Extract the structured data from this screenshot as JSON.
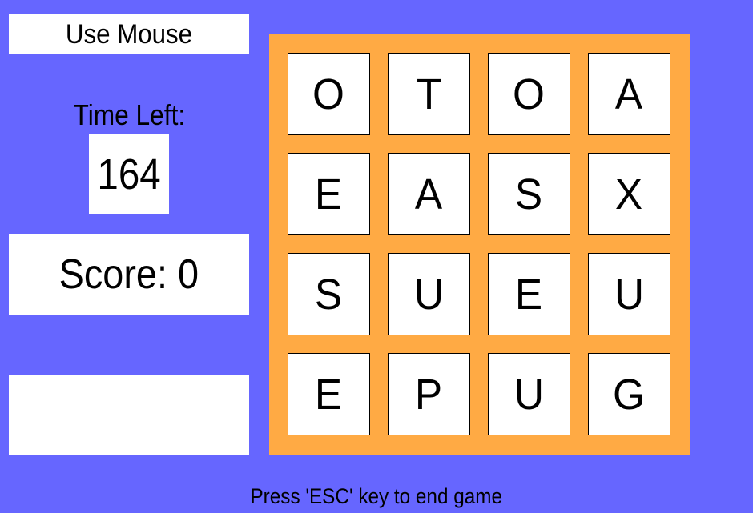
{
  "mode_label": "Use Mouse",
  "time": {
    "label": "Time Left:",
    "value": "164"
  },
  "score": {
    "label": "Score: 0"
  },
  "current_word": "",
  "board": {
    "rows": [
      [
        "O",
        "T",
        "O",
        "A"
      ],
      [
        "E",
        "A",
        "S",
        "X"
      ],
      [
        "S",
        "U",
        "E",
        "U"
      ],
      [
        "E",
        "P",
        "U",
        "G"
      ]
    ]
  },
  "footer": "Press 'ESC' key to end game",
  "colors": {
    "background": "#6666ff",
    "board": "#ffaa44",
    "tile": "#ffffff"
  }
}
